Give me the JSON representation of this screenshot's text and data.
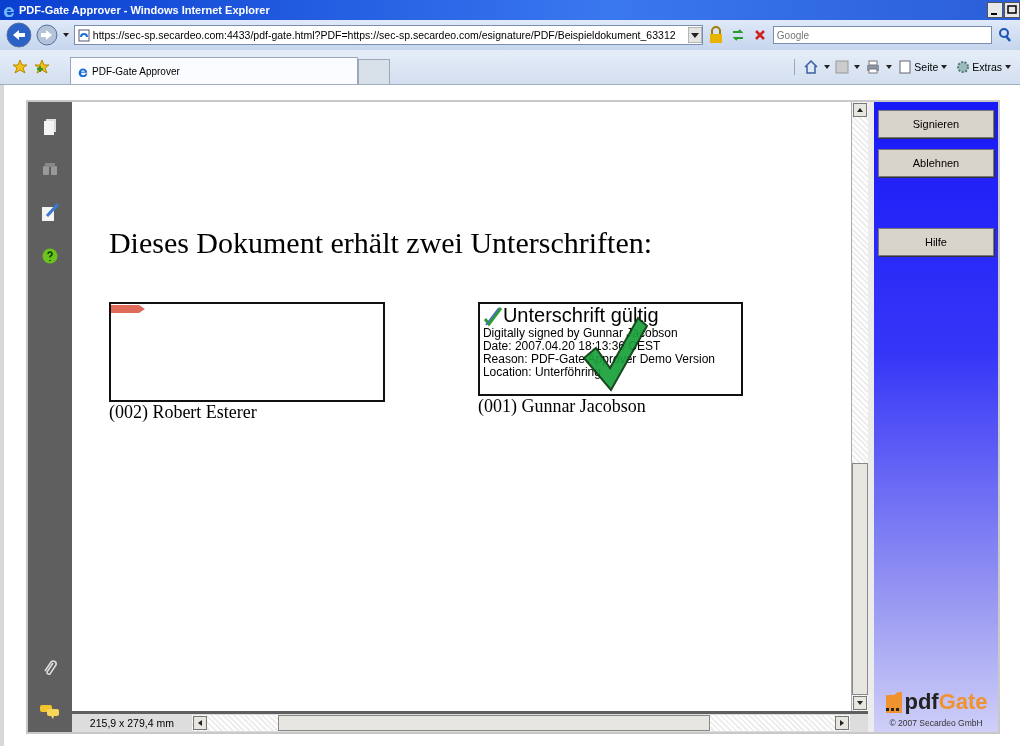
{
  "window": {
    "title": "PDF-Gate Approver - Windows Internet Explorer"
  },
  "address_bar": {
    "url": "https://sec-sp.secardeo.com:4433/pdf-gate.html?PDF=https://sec-sp.secardeo.com/esignature/PDF/Beispieldokument_63312"
  },
  "search": {
    "placeholder": "Google"
  },
  "tabs": [
    {
      "label": "PDF-Gate Approver",
      "selected": true
    }
  ],
  "command_bar": [
    {
      "label": "Seite"
    },
    {
      "label": "Extras"
    }
  ],
  "document": {
    "heading": "Dieses Dokument erhält zwei Unterschriften:",
    "signatures": [
      {
        "kind": "empty",
        "caption": "(002) Robert Esterer"
      },
      {
        "kind": "signed",
        "caption": "(001) Gunnar Jacobson",
        "status": "Unterschrift gültig",
        "lines": [
          "Digitally signed by Gunnar Jacobson",
          "Date: 2007.04.20 18:13:36 CEST",
          "Reason: PDF-Gate Approver Demo Version",
          "Location: Unterföhring"
        ]
      }
    ],
    "page_size": "215,9 x 279,4 mm"
  },
  "panel": {
    "actions": [
      "Signieren",
      "Ablehnen"
    ],
    "help": "Hilfe",
    "logo": {
      "part_1": "pdf",
      "part_2": "Gate"
    },
    "copyright": "© 2007 Secardeo GmbH"
  }
}
